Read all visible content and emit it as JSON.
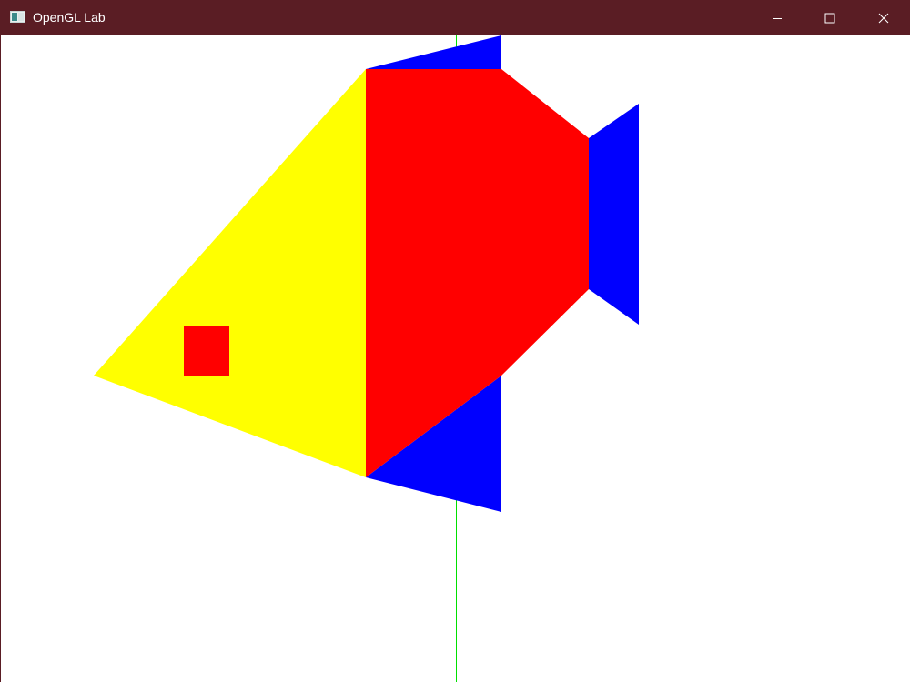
{
  "window": {
    "title": "OpenGL Lab",
    "titlebar_color": "#5a1d24",
    "controls": {
      "minimize_icon": "minimize-icon",
      "maximize_icon": "maximize-icon",
      "close_icon": "close-icon"
    }
  },
  "scene": {
    "background": "#ffffff",
    "axis_color": "#00e000",
    "colors": {
      "yellow": "#ffff00",
      "red": "#ff0000",
      "blue": "#0000ff"
    }
  }
}
